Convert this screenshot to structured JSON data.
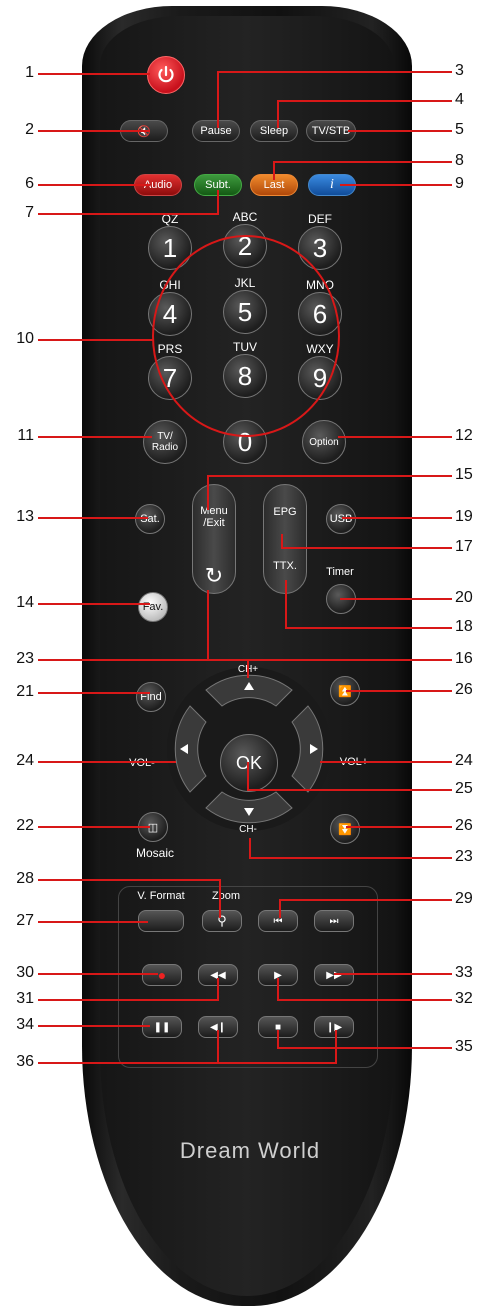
{
  "brand": "Dream World",
  "colors": {
    "leader": "#d81818",
    "power": "#e41c2c"
  },
  "buttons": {
    "mute_icon": "🔇",
    "pause": "Pause",
    "sleep": "Sleep",
    "tv_stb": "TV/STB",
    "audio": "Audio",
    "subt": "Subt.",
    "last": "Last",
    "info": "i",
    "num1": "1",
    "num2": "2",
    "num3": "3",
    "num4": "4",
    "num5": "5",
    "num6": "6",
    "num7": "7",
    "num8": "8",
    "num9": "9",
    "num0": "0",
    "tv_radio": "TV/\nRadio",
    "option": "Option",
    "sat": "Sat.",
    "menu_exit": "Menu\n/Exit",
    "epg": "EPG",
    "usb": "USB",
    "fav": "Fav.",
    "ttx": "TTX.",
    "timer": "Timer",
    "find": "Find",
    "ok": "OK",
    "vol_minus": "VOL-",
    "vol_plus": "VOL+",
    "ch_up": "CH+",
    "ch_down": "CH-",
    "mosaic": "Mosaic",
    "v_format": "V. Format",
    "zoom": "Zoom"
  },
  "letters": {
    "k1": "QZ",
    "k2": "ABC",
    "k3": "DEF",
    "k4": "GHI",
    "k5": "JKL",
    "k6": "MNO",
    "k7": "PRS",
    "k8": "TUV",
    "k9": "WXY"
  },
  "callouts": {
    "c1": "1",
    "c2": "2",
    "c3": "3",
    "c4": "4",
    "c5": "5",
    "c6": "6",
    "c7": "7",
    "c8": "8",
    "c9": "9",
    "c10": "10",
    "c11": "11",
    "c12": "12",
    "c13": "13",
    "c14": "14",
    "c15": "15",
    "c16": "16",
    "c17": "17",
    "c18": "18",
    "c19": "19",
    "c20": "20",
    "c21": "21",
    "c22": "22",
    "c23a": "23",
    "c23b": "23",
    "c24a": "24",
    "c24b": "24",
    "c25": "25",
    "c26a": "26",
    "c26b": "26",
    "c27": "27",
    "c28": "28",
    "c29": "29",
    "c30": "30",
    "c31": "31",
    "c32": "32",
    "c33": "33",
    "c34": "34",
    "c35": "35",
    "c36": "36"
  }
}
